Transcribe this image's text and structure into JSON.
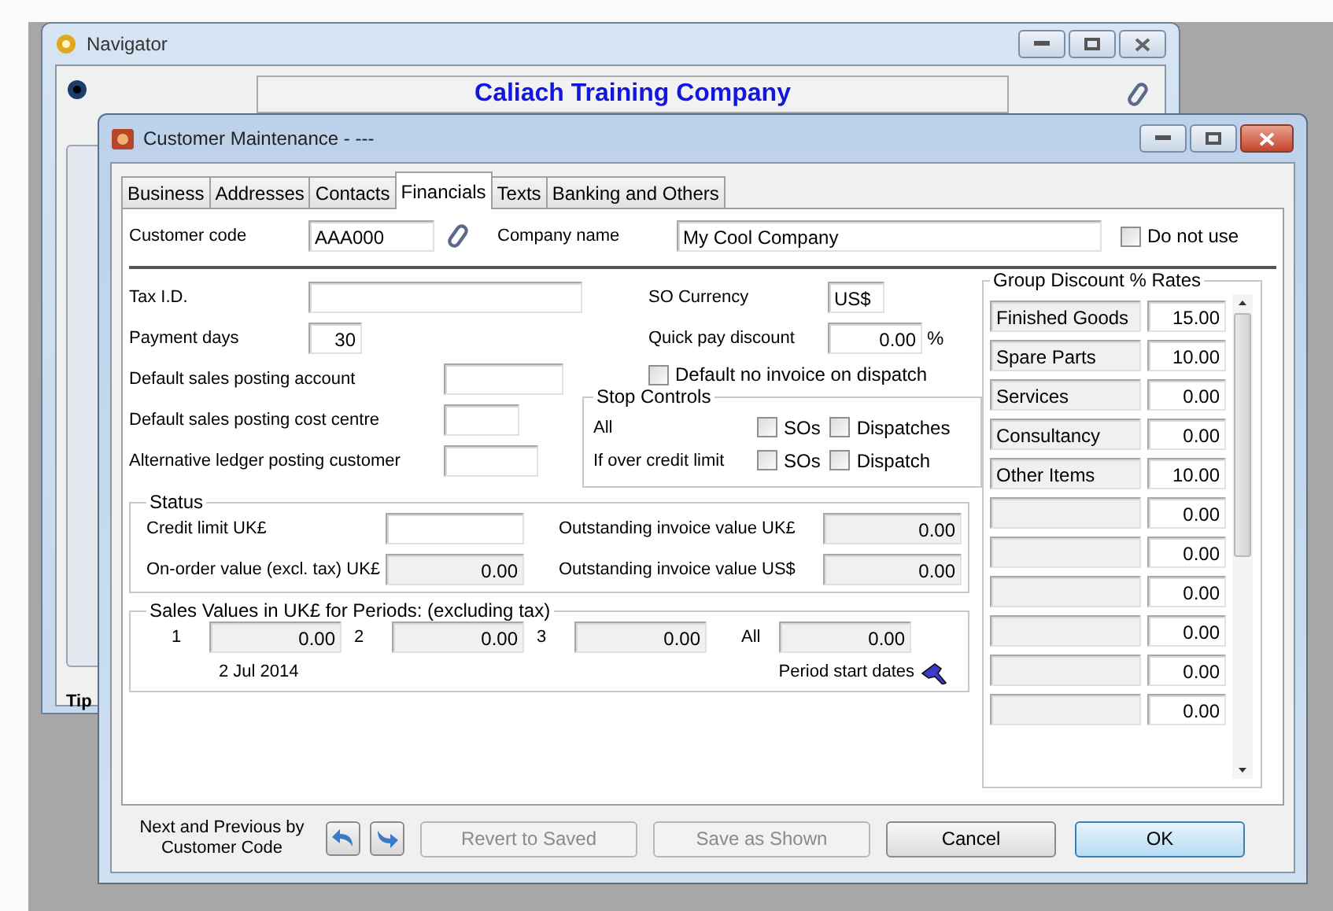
{
  "background_window": {
    "title": "Navigator",
    "company": "Caliach Training Company",
    "tip_label": "Tip"
  },
  "window": {
    "title": "Customer Maintenance -  ---"
  },
  "tabs": [
    {
      "label": "Business",
      "selected": false
    },
    {
      "label": "Addresses",
      "selected": false
    },
    {
      "label": "Contacts",
      "selected": false
    },
    {
      "label": "Financials",
      "selected": true
    },
    {
      "label": "Texts",
      "selected": false
    },
    {
      "label": "Banking and Others",
      "selected": false
    }
  ],
  "header": {
    "customer_code": {
      "label": "Customer code",
      "value": "AAA000"
    },
    "company_name": {
      "label": "Company name",
      "value": "My Cool Company"
    },
    "do_not_use": {
      "label": "Do not use",
      "checked": false
    }
  },
  "fields_left": [
    {
      "label": "Tax I.D."
    },
    {
      "label": "Payment days",
      "value": "30"
    },
    {
      "label": "Default sales posting account"
    },
    {
      "label": "Default sales posting cost centre"
    },
    {
      "label": "Alternative ledger posting customer"
    }
  ],
  "fields_right": [
    {
      "label": "SO Currency",
      "value": "US$"
    },
    {
      "label": "Quick pay discount",
      "value": "0.00",
      "suffix": "%"
    }
  ],
  "no_invoice_on_dispatch": {
    "label": "Default no invoice on dispatch",
    "checked": false
  },
  "stop_controls": {
    "title": "Stop Controls",
    "rows": [
      {
        "label": "All",
        "checks": [
          {
            "label": "SOs",
            "checked": false
          },
          {
            "label": "Dispatches",
            "checked": false
          }
        ]
      },
      {
        "label": "If over credit limit",
        "checks": [
          {
            "label": "SOs",
            "checked": false
          },
          {
            "label": "Dispatch",
            "checked": false
          }
        ]
      }
    ]
  },
  "status": {
    "title": "Status",
    "fields": [
      {
        "label": "Credit limit UK£",
        "readonly": false
      },
      {
        "label": "Outstanding invoice value UK£",
        "value": "0.00",
        "readonly": true
      },
      {
        "label": "On-order value (excl. tax) UK£",
        "value": "0.00",
        "readonly": true
      },
      {
        "label": "Outstanding invoice value US$",
        "value": "0.00",
        "readonly": true
      }
    ]
  },
  "sales_values": {
    "title": "Sales Values in UK£ for Periods: (excluding tax)",
    "periods": [
      {
        "label": "1",
        "value": "0.00"
      },
      {
        "label": "2",
        "value": "0.00"
      },
      {
        "label": "3",
        "value": "0.00"
      },
      {
        "label": "All",
        "value": "0.00"
      }
    ],
    "start_date": "2 Jul 2014",
    "start_dates_label": "Period start dates"
  },
  "group_discounts": {
    "title": "Group Discount % Rates",
    "rows": [
      {
        "group": "Finished Goods",
        "rate": "15.00"
      },
      {
        "group": "Spare Parts",
        "rate": "10.00"
      },
      {
        "group": "Services",
        "rate": "0.00"
      },
      {
        "group": "Consultancy",
        "rate": "0.00"
      },
      {
        "group": "Other Items",
        "rate": "10.00"
      },
      {
        "rate": "0.00"
      },
      {
        "rate": "0.00"
      },
      {
        "rate": "0.00"
      },
      {
        "rate": "0.00"
      },
      {
        "rate": "0.00"
      },
      {
        "rate": "0.00"
      }
    ]
  },
  "footer": {
    "nav_label": "Next and Previous by Customer Code",
    "buttons": [
      {
        "label": "Revert to Saved",
        "disabled": true,
        "default": false
      },
      {
        "label": "Save as Shown",
        "disabled": true,
        "default": false
      },
      {
        "label": "Cancel",
        "disabled": false,
        "default": false
      },
      {
        "label": "OK",
        "disabled": false,
        "default": true
      }
    ]
  }
}
